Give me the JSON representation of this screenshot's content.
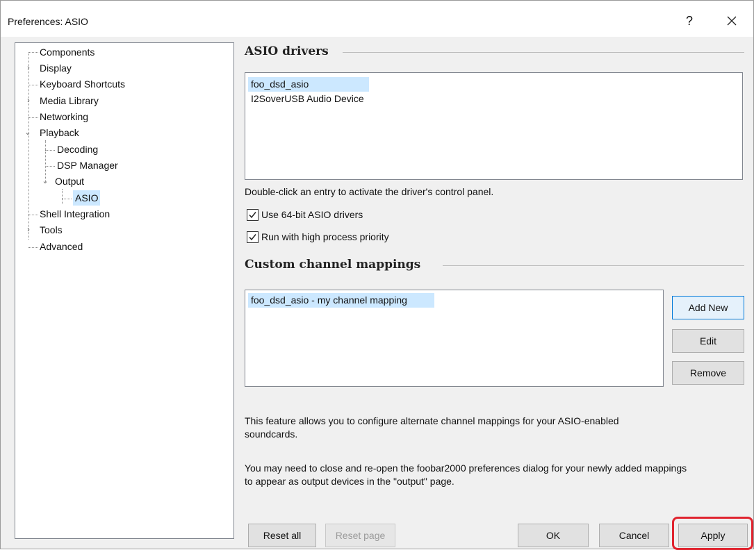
{
  "window": {
    "title": "Preferences: ASIO",
    "help_glyph": "?",
    "close_glyph": "×"
  },
  "tree": {
    "items": [
      {
        "label": "Components"
      },
      {
        "label": "Display"
      },
      {
        "label": "Keyboard Shortcuts"
      },
      {
        "label": "Media Library"
      },
      {
        "label": "Networking"
      },
      {
        "label": "Playback"
      },
      {
        "label": "Decoding"
      },
      {
        "label": "DSP Manager"
      },
      {
        "label": "Output"
      },
      {
        "label": "ASIO"
      },
      {
        "label": "Shell Integration"
      },
      {
        "label": "Tools"
      },
      {
        "label": "Advanced"
      }
    ],
    "expand_glyph": "›",
    "collapse_glyph": "⌄"
  },
  "asio_drivers": {
    "title": "ASIO drivers",
    "items": [
      "foo_dsd_asio",
      "I2SoverUSB Audio Device"
    ],
    "hint": "Double-click an entry to activate the driver's control panel.",
    "use64_label": "Use 64-bit ASIO drivers",
    "priority_label": "Run with high process priority"
  },
  "mappings": {
    "title": "Custom channel mappings",
    "items": [
      "foo_dsd_asio - my channel mapping"
    ],
    "add_label": "Add New",
    "edit_label": "Edit",
    "remove_label": "Remove",
    "info1": "This feature allows you to configure alternate channel mappings for your ASIO-enabled soundcards.",
    "info2": "You may need to close and re-open the foobar2000 preferences dialog for your newly added mappings to appear as output devices in the \"output\" page."
  },
  "footer": {
    "reset_all": "Reset all",
    "reset_page": "Reset page",
    "ok": "OK",
    "cancel": "Cancel",
    "apply": "Apply"
  },
  "colors": {
    "selection": "#cce8ff",
    "highlight": "#e0242f"
  }
}
